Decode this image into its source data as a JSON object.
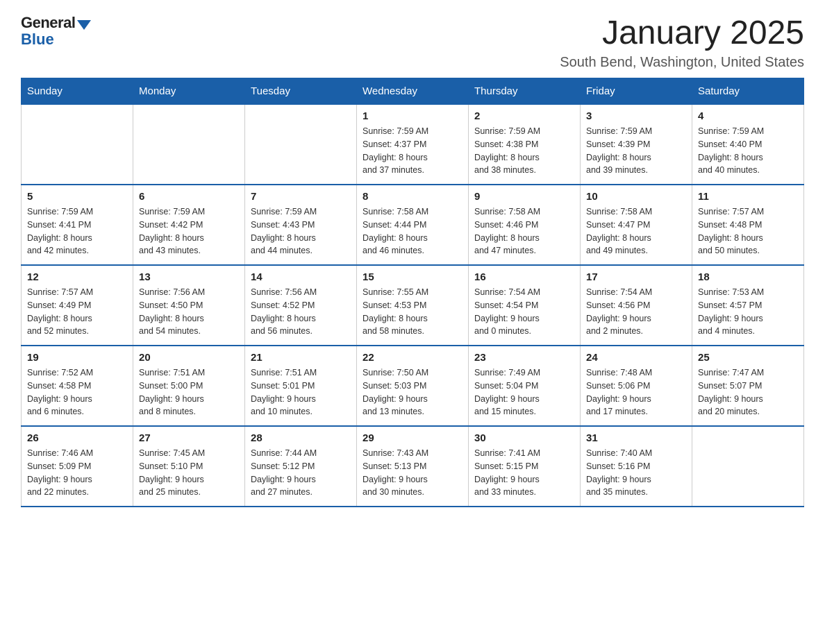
{
  "header": {
    "logo_general": "General",
    "logo_blue": "Blue",
    "month_title": "January 2025",
    "location": "South Bend, Washington, United States"
  },
  "weekdays": [
    "Sunday",
    "Monday",
    "Tuesday",
    "Wednesday",
    "Thursday",
    "Friday",
    "Saturday"
  ],
  "weeks": [
    [
      {
        "day": "",
        "info": ""
      },
      {
        "day": "",
        "info": ""
      },
      {
        "day": "",
        "info": ""
      },
      {
        "day": "1",
        "info": "Sunrise: 7:59 AM\nSunset: 4:37 PM\nDaylight: 8 hours\nand 37 minutes."
      },
      {
        "day": "2",
        "info": "Sunrise: 7:59 AM\nSunset: 4:38 PM\nDaylight: 8 hours\nand 38 minutes."
      },
      {
        "day": "3",
        "info": "Sunrise: 7:59 AM\nSunset: 4:39 PM\nDaylight: 8 hours\nand 39 minutes."
      },
      {
        "day": "4",
        "info": "Sunrise: 7:59 AM\nSunset: 4:40 PM\nDaylight: 8 hours\nand 40 minutes."
      }
    ],
    [
      {
        "day": "5",
        "info": "Sunrise: 7:59 AM\nSunset: 4:41 PM\nDaylight: 8 hours\nand 42 minutes."
      },
      {
        "day": "6",
        "info": "Sunrise: 7:59 AM\nSunset: 4:42 PM\nDaylight: 8 hours\nand 43 minutes."
      },
      {
        "day": "7",
        "info": "Sunrise: 7:59 AM\nSunset: 4:43 PM\nDaylight: 8 hours\nand 44 minutes."
      },
      {
        "day": "8",
        "info": "Sunrise: 7:58 AM\nSunset: 4:44 PM\nDaylight: 8 hours\nand 46 minutes."
      },
      {
        "day": "9",
        "info": "Sunrise: 7:58 AM\nSunset: 4:46 PM\nDaylight: 8 hours\nand 47 minutes."
      },
      {
        "day": "10",
        "info": "Sunrise: 7:58 AM\nSunset: 4:47 PM\nDaylight: 8 hours\nand 49 minutes."
      },
      {
        "day": "11",
        "info": "Sunrise: 7:57 AM\nSunset: 4:48 PM\nDaylight: 8 hours\nand 50 minutes."
      }
    ],
    [
      {
        "day": "12",
        "info": "Sunrise: 7:57 AM\nSunset: 4:49 PM\nDaylight: 8 hours\nand 52 minutes."
      },
      {
        "day": "13",
        "info": "Sunrise: 7:56 AM\nSunset: 4:50 PM\nDaylight: 8 hours\nand 54 minutes."
      },
      {
        "day": "14",
        "info": "Sunrise: 7:56 AM\nSunset: 4:52 PM\nDaylight: 8 hours\nand 56 minutes."
      },
      {
        "day": "15",
        "info": "Sunrise: 7:55 AM\nSunset: 4:53 PM\nDaylight: 8 hours\nand 58 minutes."
      },
      {
        "day": "16",
        "info": "Sunrise: 7:54 AM\nSunset: 4:54 PM\nDaylight: 9 hours\nand 0 minutes."
      },
      {
        "day": "17",
        "info": "Sunrise: 7:54 AM\nSunset: 4:56 PM\nDaylight: 9 hours\nand 2 minutes."
      },
      {
        "day": "18",
        "info": "Sunrise: 7:53 AM\nSunset: 4:57 PM\nDaylight: 9 hours\nand 4 minutes."
      }
    ],
    [
      {
        "day": "19",
        "info": "Sunrise: 7:52 AM\nSunset: 4:58 PM\nDaylight: 9 hours\nand 6 minutes."
      },
      {
        "day": "20",
        "info": "Sunrise: 7:51 AM\nSunset: 5:00 PM\nDaylight: 9 hours\nand 8 minutes."
      },
      {
        "day": "21",
        "info": "Sunrise: 7:51 AM\nSunset: 5:01 PM\nDaylight: 9 hours\nand 10 minutes."
      },
      {
        "day": "22",
        "info": "Sunrise: 7:50 AM\nSunset: 5:03 PM\nDaylight: 9 hours\nand 13 minutes."
      },
      {
        "day": "23",
        "info": "Sunrise: 7:49 AM\nSunset: 5:04 PM\nDaylight: 9 hours\nand 15 minutes."
      },
      {
        "day": "24",
        "info": "Sunrise: 7:48 AM\nSunset: 5:06 PM\nDaylight: 9 hours\nand 17 minutes."
      },
      {
        "day": "25",
        "info": "Sunrise: 7:47 AM\nSunset: 5:07 PM\nDaylight: 9 hours\nand 20 minutes."
      }
    ],
    [
      {
        "day": "26",
        "info": "Sunrise: 7:46 AM\nSunset: 5:09 PM\nDaylight: 9 hours\nand 22 minutes."
      },
      {
        "day": "27",
        "info": "Sunrise: 7:45 AM\nSunset: 5:10 PM\nDaylight: 9 hours\nand 25 minutes."
      },
      {
        "day": "28",
        "info": "Sunrise: 7:44 AM\nSunset: 5:12 PM\nDaylight: 9 hours\nand 27 minutes."
      },
      {
        "day": "29",
        "info": "Sunrise: 7:43 AM\nSunset: 5:13 PM\nDaylight: 9 hours\nand 30 minutes."
      },
      {
        "day": "30",
        "info": "Sunrise: 7:41 AM\nSunset: 5:15 PM\nDaylight: 9 hours\nand 33 minutes."
      },
      {
        "day": "31",
        "info": "Sunrise: 7:40 AM\nSunset: 5:16 PM\nDaylight: 9 hours\nand 35 minutes."
      },
      {
        "day": "",
        "info": ""
      }
    ]
  ]
}
